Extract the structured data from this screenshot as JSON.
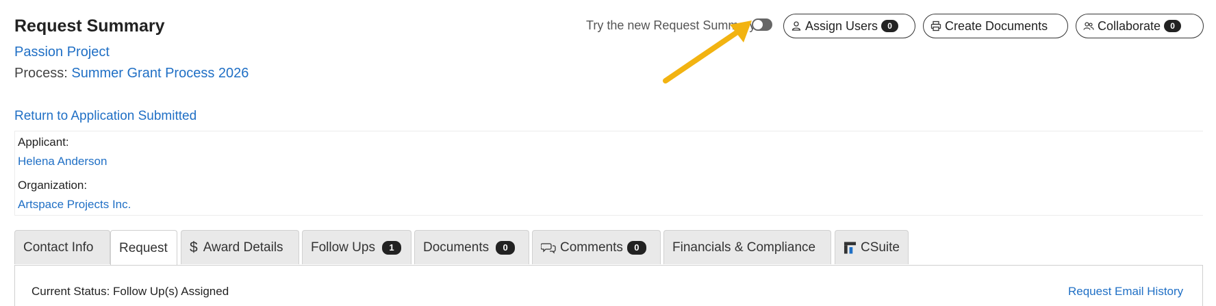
{
  "header": {
    "title": "Request Summary",
    "project": "Passion Project",
    "process_label": "Process:",
    "process_name": "Summer Grant Process 2026",
    "return_link": "Return to Application Submitted"
  },
  "toolbar": {
    "toggle_label": "Try the new Request Summary",
    "toggle_on": false,
    "assign_users": {
      "label": "Assign Users",
      "count": "0",
      "icon": "user-icon"
    },
    "create_documents": {
      "label": "Create Documents",
      "icon": "printer-icon"
    },
    "collaborate": {
      "label": "Collaborate",
      "count": "0",
      "icon": "users-icon"
    }
  },
  "annotation": {
    "arrow_color": "#f2b311"
  },
  "info": {
    "applicant_label": "Applicant:",
    "applicant_name": "Helena Anderson",
    "organization_label": "Organization:",
    "organization_name": "Artspace Projects Inc."
  },
  "tabs": [
    {
      "label": "Contact Info"
    },
    {
      "label": "Request",
      "active": true
    },
    {
      "label": "Award Details",
      "icon": "dollar-icon"
    },
    {
      "label": "Follow Ups",
      "count": "1"
    },
    {
      "label": "Documents",
      "count": "0"
    },
    {
      "label": "Comments",
      "count": "0",
      "icon": "comments-icon"
    },
    {
      "label": "Financials & Compliance"
    },
    {
      "label": "CSuite",
      "icon": "csuite-logo-icon"
    }
  ],
  "panel": {
    "status": "Current Status: Follow Up(s) Assigned",
    "email_history": "Request Email History"
  },
  "colors": {
    "link": "#1f6fc5",
    "badge": "#222222",
    "tab_bg": "#e9e9e9"
  }
}
